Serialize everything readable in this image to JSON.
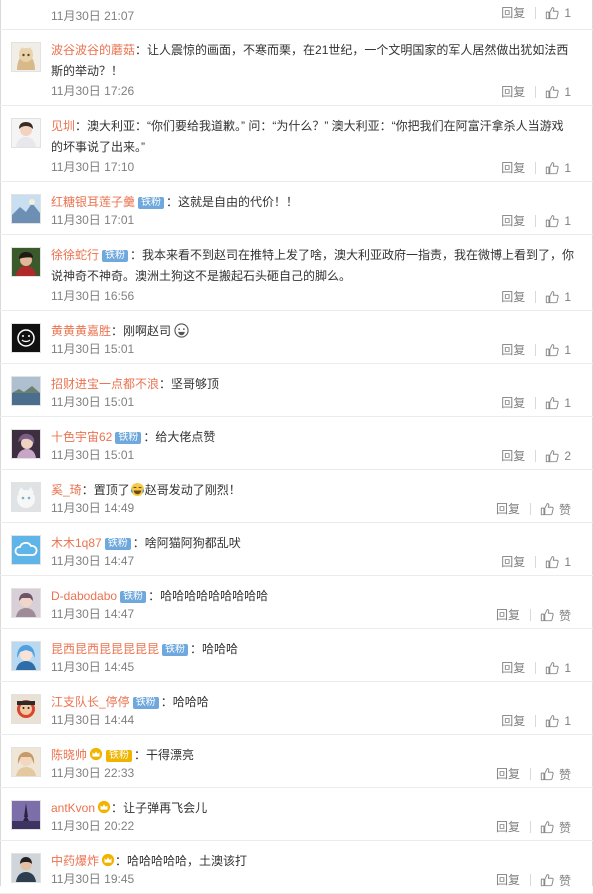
{
  "labels": {
    "reply": "回复",
    "zan": "赞",
    "separator": "："
  },
  "comments": [
    {
      "name": "",
      "badge": "",
      "text": "",
      "time": "11月30日 21:07",
      "likes": "1"
    },
    {
      "name": "波谷波谷的蘑菇",
      "badge": "",
      "text": "让人震惊的画面，不寒而栗，在21世纪，一个文明国家的军人居然做出犹如法西斯的举动？！",
      "time": "11月30日 17:26",
      "likes": "1"
    },
    {
      "name": "见圳",
      "badge": "",
      "text": "澳大利亚：“你们要给我道歉。” 问：“为什么？” 澳大利亚：“你把我们在阿富汗拿杀人当游戏的坏事说了出来。”",
      "time": "11月30日 17:10",
      "likes": "1"
    },
    {
      "name": "红糖银耳莲子羹",
      "badge": "铁粉",
      "text": "这就是自由的代价！！",
      "time": "11月30日 17:01",
      "likes": "1"
    },
    {
      "name": "徐徐蛇行",
      "badge": "铁粉",
      "text": "我本来看不到赵司在推特上发了啥，澳大利亚政府一指责，我在微博上看到了，你说神奇不神奇。澳洲土狗这不是搬起石头砸自己的脚么。",
      "time": "11月30日 16:56",
      "likes": "1"
    },
    {
      "name": "黄黄黄嘉胜",
      "badge": "",
      "text": "刚啊赵司",
      "time": "11月30日 15:01",
      "likes": "1"
    },
    {
      "name": "招财进宝一点都不浪",
      "badge": "",
      "text": "坚哥够顶",
      "time": "11月30日 15:01",
      "likes": "1"
    },
    {
      "name": "十色宇宙62",
      "badge": "铁粉",
      "text": "给大佬点赞",
      "time": "11月30日 15:01",
      "likes": "2"
    },
    {
      "name": "奚_琦",
      "badge": "",
      "text": "置顶了",
      "text2": "赵哥发动了刚烈！",
      "time": "11月30日 14:49",
      "likes": ""
    },
    {
      "name": "木木1q87",
      "badge": "铁粉",
      "text": "啥阿猫阿狗都乱吠",
      "time": "11月30日 14:47",
      "likes": "1"
    },
    {
      "name": "D-dabodabo",
      "badge": "铁粉",
      "text": "哈哈哈哈哈哈哈哈哈",
      "time": "11月30日 14:47",
      "likes": ""
    },
    {
      "name": "昆西昆西昆昆昆昆昆",
      "badge": "铁粉",
      "text": "哈哈哈",
      "time": "11月30日 14:45",
      "likes": "1"
    },
    {
      "name": "江支队长_停停",
      "badge": "铁粉",
      "text": "哈哈哈",
      "time": "11月30日 14:44",
      "likes": "1"
    },
    {
      "name": "陈晓帅",
      "badge": "铁粉",
      "text": "干得漂亮",
      "time": "11月30日 22:33",
      "likes": ""
    },
    {
      "name": "antKvon",
      "badge": "",
      "text": "让子弹再飞会儿",
      "time": "11月30日 20:22",
      "likes": ""
    },
    {
      "name": "中药爆炸",
      "badge": "",
      "text": "哈哈哈哈哈，土澳该打",
      "time": "11月30日 19:45",
      "likes": ""
    }
  ],
  "colors": {
    "username": "#eb7350",
    "meta": "#808080",
    "badge": "#6fa8dc",
    "badge_gold": "#f0b400"
  }
}
